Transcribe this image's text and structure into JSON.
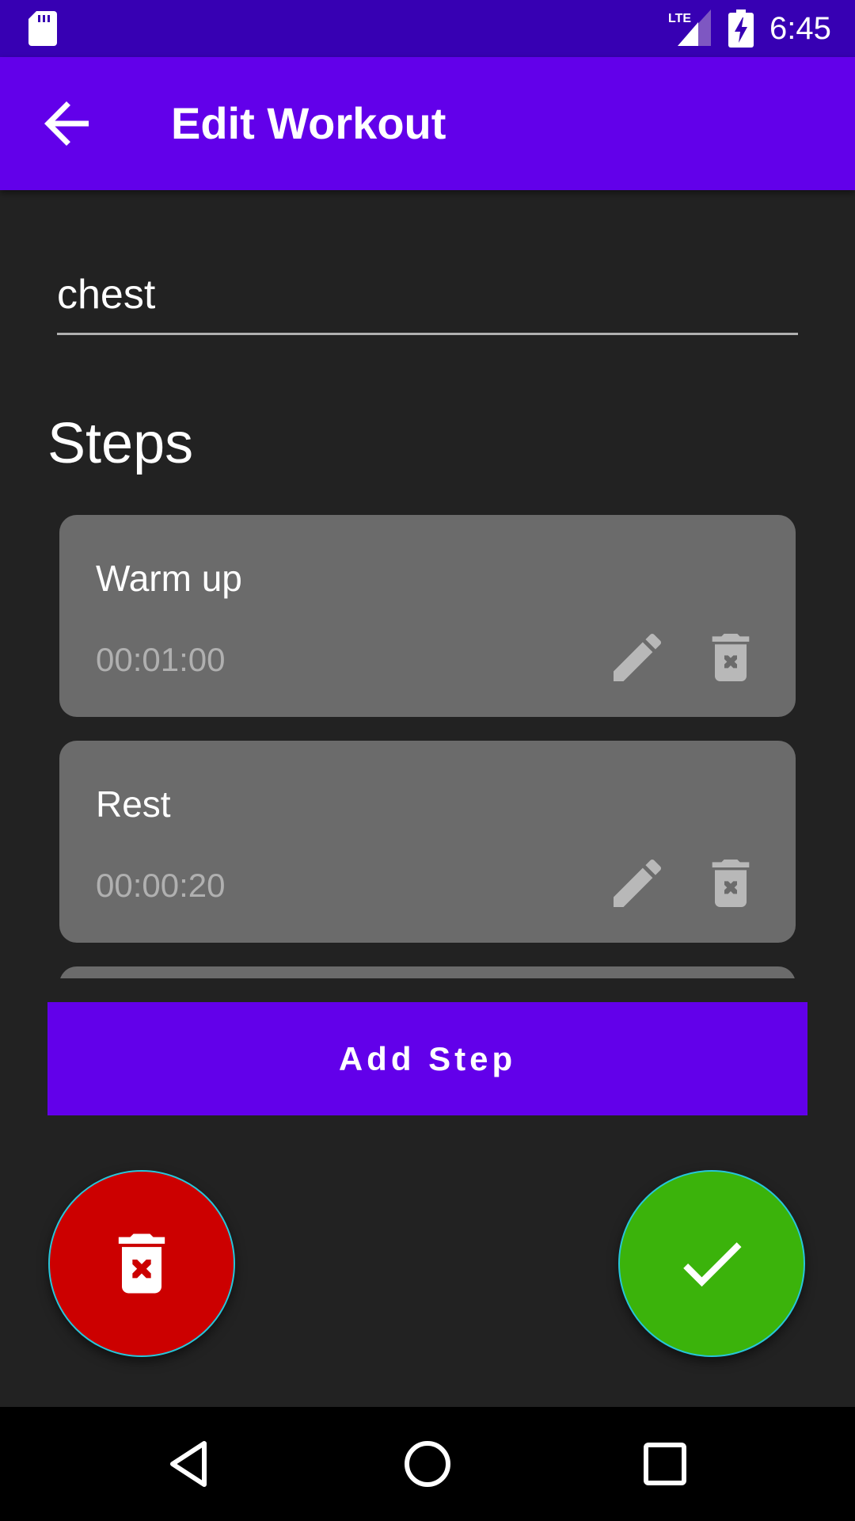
{
  "status_bar": {
    "time": "6:45",
    "network_label": "LTE",
    "icons": [
      "sd-card-icon",
      "lte-signal-icon",
      "battery-charging-icon"
    ]
  },
  "app_bar": {
    "title": "Edit Workout",
    "back_icon": "arrow-back-icon"
  },
  "workout": {
    "name": "chest"
  },
  "steps_section": {
    "heading": "Steps",
    "items": [
      {
        "name": "Warm up",
        "duration": "00:01:00",
        "edit_icon": "pencil-icon",
        "delete_icon": "trash-icon"
      },
      {
        "name": "Rest",
        "duration": "00:00:20",
        "edit_icon": "pencil-icon",
        "delete_icon": "trash-icon"
      }
    ]
  },
  "add_step": {
    "label": "Add Step"
  },
  "fabs": {
    "delete": {
      "icon": "trash-icon",
      "color": "#cc0000"
    },
    "confirm": {
      "icon": "check-icon",
      "color": "#3bb30b"
    }
  },
  "nav_bar": {
    "icons": [
      "nav-back-icon",
      "nav-home-icon",
      "nav-recents-icon"
    ]
  },
  "colors": {
    "primary": "#6200ea",
    "primary_dark": "#3700b3",
    "background": "#222222",
    "card": "#6b6b6b"
  }
}
